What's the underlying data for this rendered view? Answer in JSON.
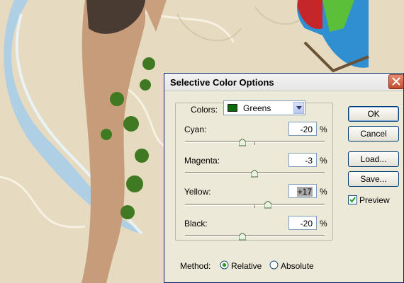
{
  "dialog": {
    "title": "Selective Color Options",
    "colors_label": "Colors:",
    "colors_value": "Greens",
    "swatch_color": "#0b6a0b",
    "sliders": [
      {
        "label": "Cyan:",
        "value": "-20",
        "unit": "%",
        "selected": false
      },
      {
        "label": "Magenta:",
        "value": "-3",
        "unit": "%",
        "selected": false
      },
      {
        "label": "Yellow:",
        "value": "+17",
        "unit": "%",
        "selected": true
      },
      {
        "label": "Black:",
        "value": "-20",
        "unit": "%",
        "selected": false
      }
    ],
    "method_label": "Method:",
    "method_options": [
      "Relative",
      "Absolute"
    ],
    "method_selected": "Relative",
    "buttons": {
      "ok": "OK",
      "cancel": "Cancel",
      "load": "Load...",
      "save": "Save..."
    },
    "preview_label": "Preview",
    "preview_checked": true
  }
}
